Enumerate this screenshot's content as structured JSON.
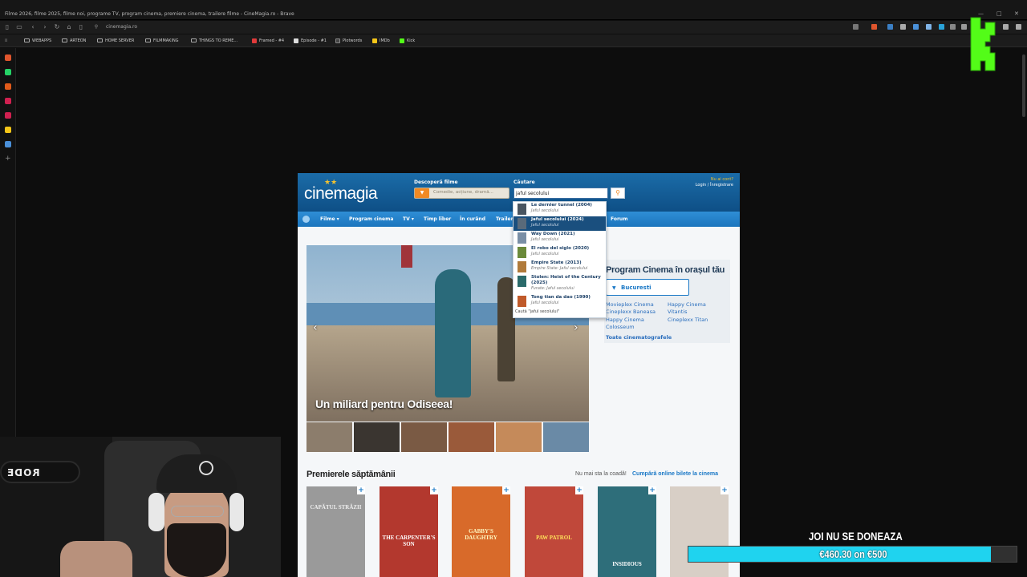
{
  "browser": {
    "window_title": "Filme 2026, filme 2025, filme noi, programe TV, program cinema, premiere cinema, trailere filme - CineMagia.ro - Brave",
    "url": "cinemagia.ro",
    "bookmarks": [
      {
        "label": "WEBAPPS",
        "icon": "folder-icon"
      },
      {
        "label": "ARTEON",
        "icon": "folder-icon"
      },
      {
        "label": "HOME SERVER",
        "icon": "folder-icon"
      },
      {
        "label": "FILMMAKING",
        "icon": "folder-icon"
      },
      {
        "label": "THINGS TO REME...",
        "icon": "folder-icon"
      },
      {
        "label": "Framed - #4",
        "icon": "framed-icon"
      },
      {
        "label": "Episode - #1",
        "icon": "episode-icon"
      },
      {
        "label": "Plotwords",
        "icon": "plotwords-icon"
      },
      {
        "label": "IMDb",
        "icon": "imdb-icon"
      },
      {
        "label": "Kick",
        "icon": "kick-icon"
      }
    ]
  },
  "site": {
    "logo": "cinemagia",
    "discover_label": "Descoperă filme",
    "discover_placeholder": "Comedie, acțiune, dramă...",
    "search_label": "Căutare",
    "search_value": "jaful secolului",
    "account_question": "Nu ai cont?",
    "account_login": "Login / Înregistrare",
    "menu": [
      "Filme ▾",
      "Program cinema",
      "TV ▾",
      "Timp liber",
      "În curând",
      "Trailer",
      "Forum"
    ],
    "hero_caption": "Un miliard pentru Odiseea!",
    "autocomplete": [
      {
        "title": "Le dernier tunnel (2004)",
        "sub": "Jaful secolului",
        "active": false
      },
      {
        "title": "Jaful secolului (2024)",
        "sub": "Jaful secolului",
        "active": true
      },
      {
        "title": "Way Down (2021)",
        "sub": "Jaful secolului",
        "active": false
      },
      {
        "title": "El robo del siglo (2020)",
        "sub": "Jaful secolului",
        "active": false
      },
      {
        "title": "Empire State (2013)",
        "sub": "Empire State: Jaful secolului",
        "active": false
      },
      {
        "title": "Stolen: Heist of the Century (2025)",
        "sub": "Furate: Jaful secolului",
        "active": false
      },
      {
        "title": "Tong tian da dao (1990)",
        "sub": "Jaful secolului",
        "active": false
      }
    ],
    "autocomplete_footer": "Caută \"jaful secolului\"",
    "cinema_box": {
      "title": "Program Cinema în orașul tău",
      "city": "Bucuresti",
      "cinemas": [
        "Movieplex Cinema",
        "Happy Cinema",
        "Cineplexx Baneasa",
        "Vitantis",
        "Happy Cinema Colosseum",
        "Cineplexx Titan"
      ],
      "all_link": "Toate cinematografele"
    },
    "premieres_title": "Premierele săptămânii",
    "premieres_note": "Nu mai sta la coadă!",
    "premieres_link": "Cumpără online bilete la cinema",
    "posters": [
      {
        "text": "CAPĂTUL STRĂZII",
        "color": "#9a9a9a"
      },
      {
        "text": "THE CARPENTER'S SON",
        "color": "#b3382e"
      },
      {
        "text": "GABBY'S DAUGHTRY",
        "color": "#d86a2a"
      },
      {
        "text": "PAW PATROL",
        "color": "#c0483a"
      },
      {
        "text": "INSIDIOUS",
        "color": "#2e6e7a"
      },
      {
        "text": "",
        "color": "#d8cfc6"
      }
    ]
  },
  "overlay": {
    "mic_brand": "RODE",
    "donation_title": "JOI NU SE DONEAZA",
    "donation_text": "€460.30 on €500",
    "donation_progress": 0.9206
  }
}
